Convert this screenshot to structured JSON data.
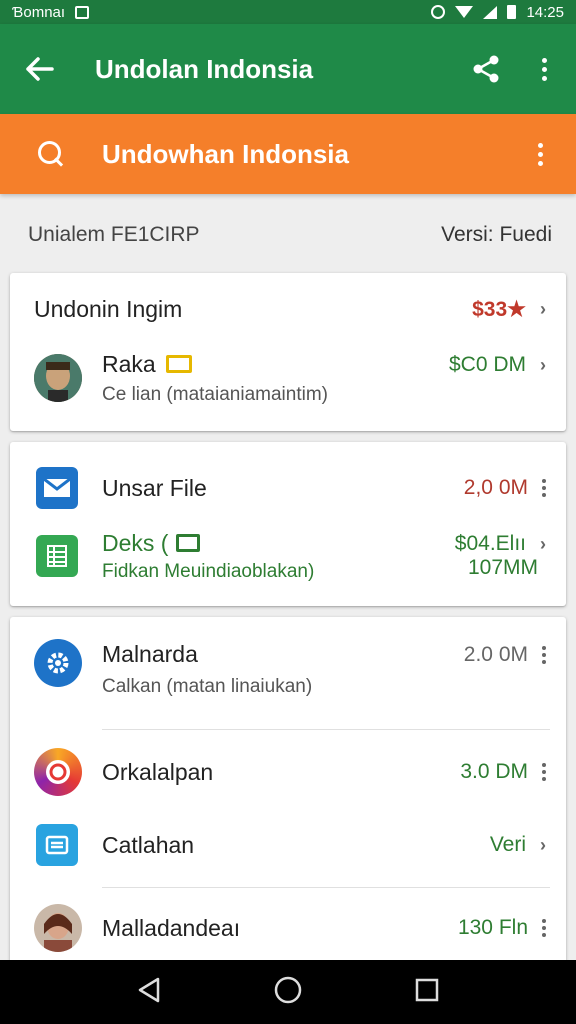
{
  "status_bar": {
    "carrier": "Ɓomnaı",
    "time": "14:25"
  },
  "app_bar": {
    "title": "Undolan Indonsia",
    "icons": [
      "back-arrow-icon",
      "share-icon",
      "more-vert-icon"
    ]
  },
  "search_bar": {
    "text": "Undowhan Indonsia",
    "icons": [
      "search-icon",
      "more-vert-icon"
    ]
  },
  "subheader": {
    "left": "Unialem FE1CIRP",
    "right": "Versi: Fuedi"
  },
  "card1": {
    "header": {
      "title": "Undonin Ingim",
      "price": "$33★"
    },
    "item": {
      "name": "Raka",
      "subtitle": "Ce lian (mataianiamaintim)",
      "price": "$C0 DM"
    }
  },
  "card2": {
    "items": [
      {
        "name": "Unsar File",
        "subtitle": "",
        "price": "2,0 0M",
        "icon": "mail-icon"
      },
      {
        "name": "Deks (",
        "subtitle": "Fidkan Meuindiaoblakan)",
        "price": "$04.Elıı",
        "price2": "107MM",
        "icon": "sheets-icon"
      }
    ]
  },
  "card3": {
    "items": [
      {
        "name": "Malnarda",
        "subtitle": "Calkan (matan linaiukan)",
        "price": "2.0 0M",
        "icon": "settings-icon"
      },
      {
        "name": "Orkalalpan",
        "subtitle": "",
        "price": "3.0 DM",
        "icon": "camera-icon"
      },
      {
        "name": "Catlahan",
        "subtitle": "",
        "price": "Veri",
        "icon": "notes-icon"
      },
      {
        "name": "Malladandeaı",
        "subtitle": "",
        "price": "130 Fln",
        "icon": "avatar-photo"
      }
    ]
  },
  "colors": {
    "app_bar": "#1f8a48",
    "search_bar": "#f57f2a",
    "price_green": "#2e7d32",
    "price_red": "#c0392b"
  }
}
